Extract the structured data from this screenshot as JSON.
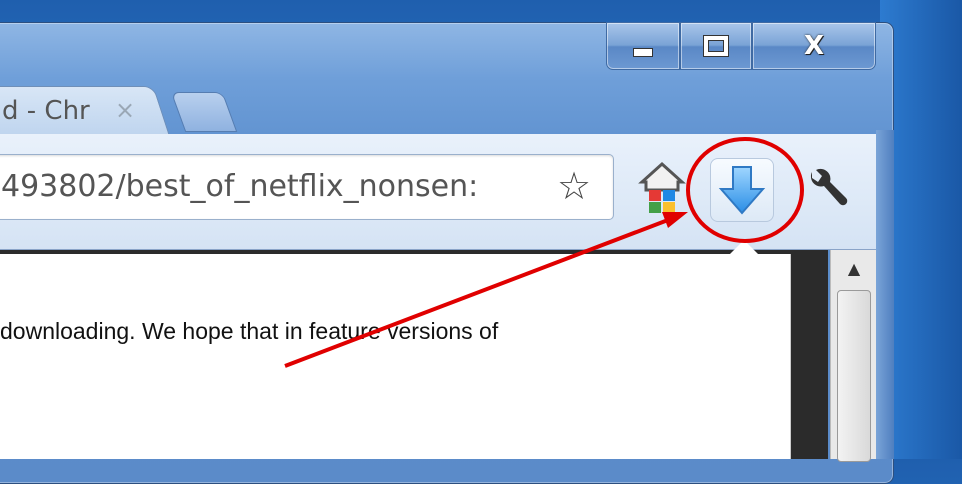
{
  "window": {
    "caption_buttons": {
      "minimize_icon": "minimize-icon",
      "maximize_icon": "maximize-icon",
      "close_label": "X"
    }
  },
  "tab": {
    "title": "d - Chr",
    "close_label": "×"
  },
  "omnibox": {
    "url": "493802/best_of_netflix_nonsen:",
    "star_icon": "☆"
  },
  "toolbar": {
    "home_icon": "home-icon",
    "download_icon": "download-icon",
    "wrench_icon": "wrench-icon"
  },
  "download_panel": {
    "text": "downloading. We hope that in feature versions of"
  },
  "annotation": {
    "color": "#e00000"
  }
}
